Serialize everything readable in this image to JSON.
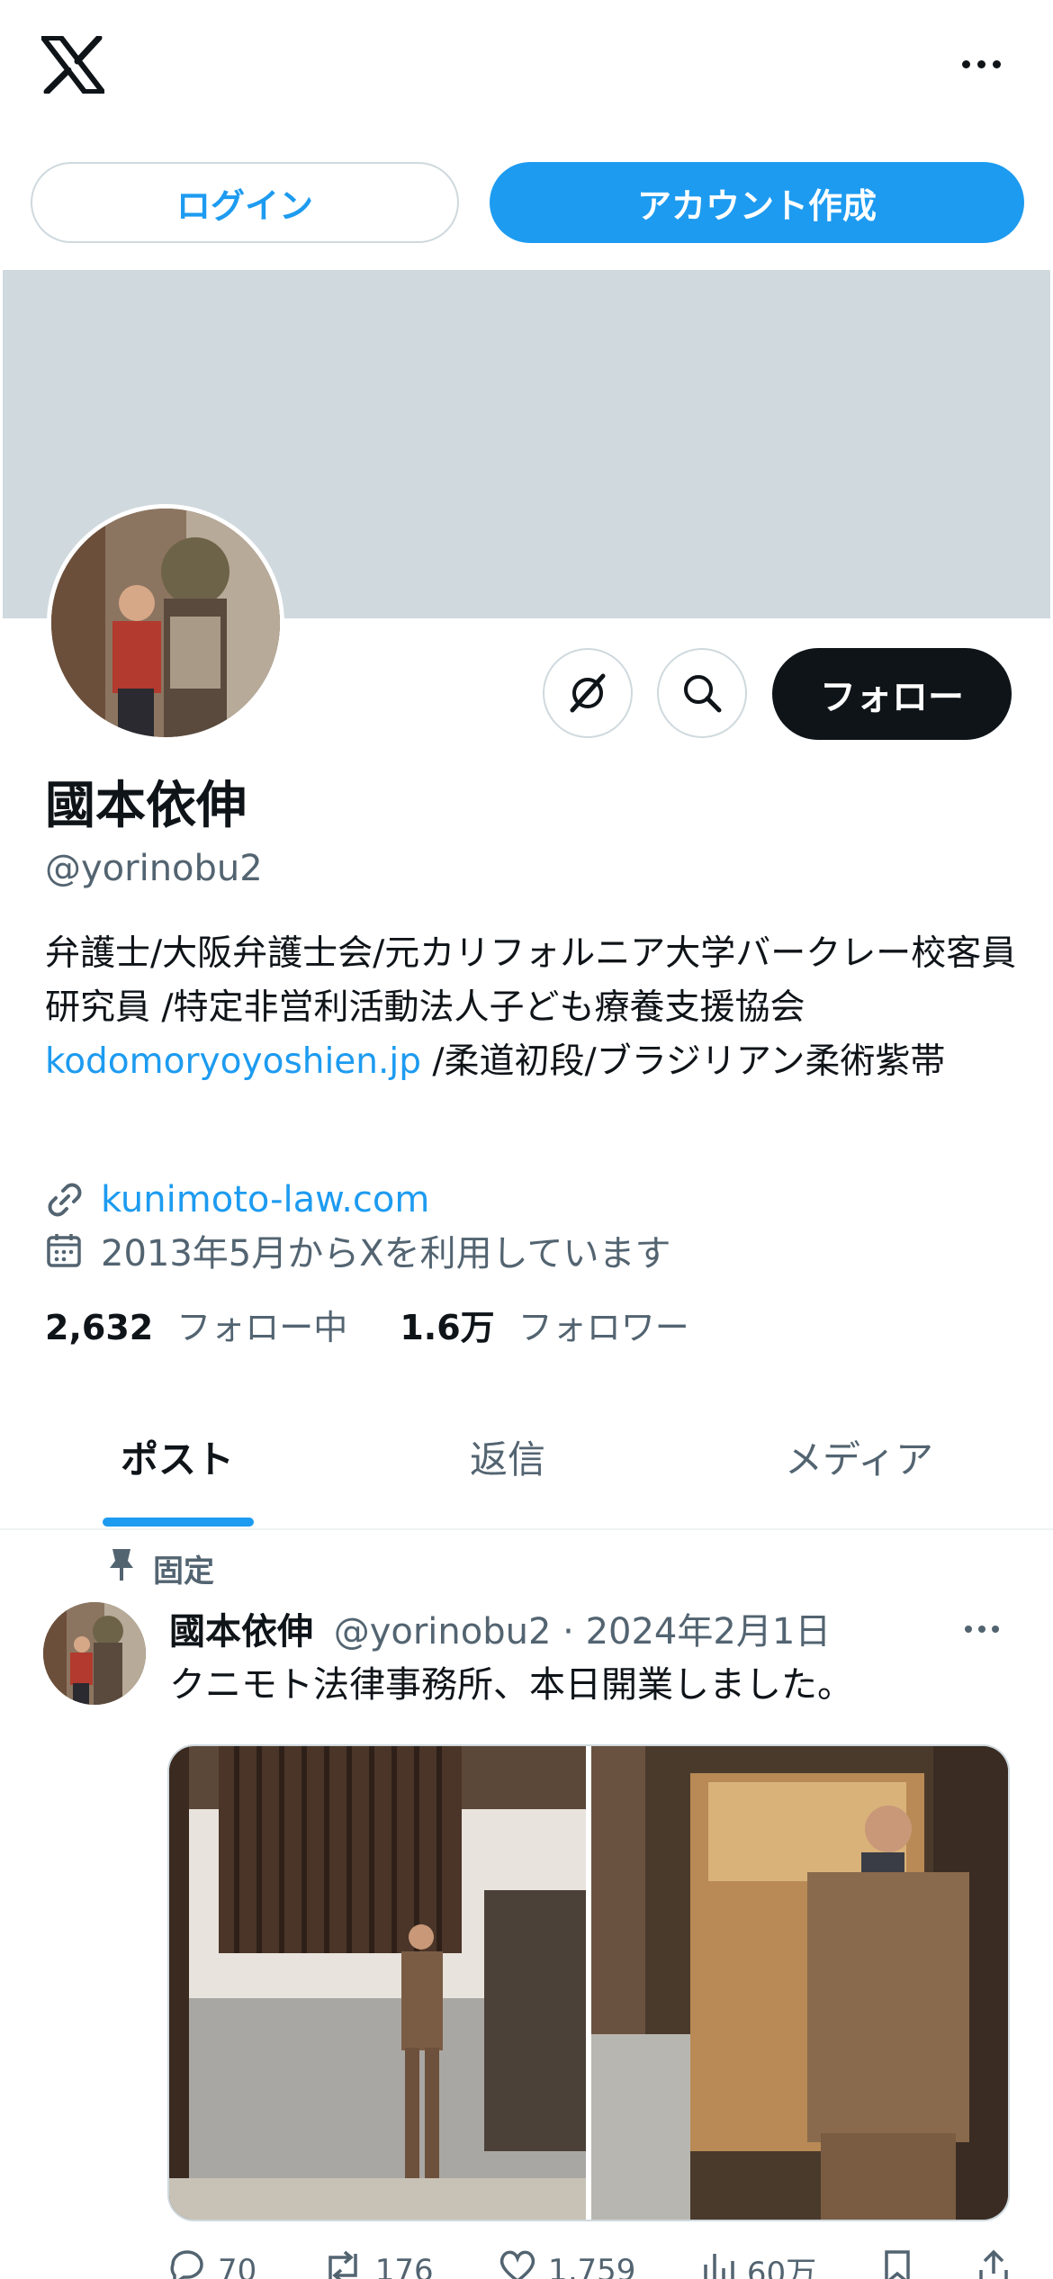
{
  "header": {
    "logo_icon": "x-logo-icon",
    "more_icon": "more-horizontal-icon"
  },
  "auth": {
    "login_label": "ログイン",
    "signup_label": "アカウント作成"
  },
  "profile": {
    "name": "國本依伸",
    "handle": "@yorinobu2",
    "follow_label": "フォロー",
    "bio_part1": "弁護士/大阪弁護士会/元カリフォルニア大学バークレー校客員研究員 /特定非営利活動法人子ども療養支援協会",
    "bio_link": "kodomoryoyoshien.jp",
    "bio_part2": " /柔道初段/ブラジリアン柔術紫帯",
    "website": "kunimoto-law.com",
    "joined": "2013年5月からXを利用しています",
    "following_count": "2,632",
    "following_label": "フォロー中",
    "followers_count": "1.6万",
    "followers_label": "フォロワー"
  },
  "tabs": [
    {
      "label": "ポスト",
      "active": true
    },
    {
      "label": "返信",
      "active": false
    },
    {
      "label": "メディア",
      "active": false
    }
  ],
  "post": {
    "pinned_label": "固定",
    "author": "國本依伸",
    "meta": "@yorinobu2 · 2024年2月1日",
    "text": "クニモト法律事務所、本日開業しました。",
    "replies": "70",
    "reposts": "176",
    "likes": "1,759",
    "views": "60万"
  },
  "colors": {
    "accent": "#1d9bf0",
    "banner": "#cfd9de",
    "text": "#0f1419",
    "muted": "#536471"
  }
}
